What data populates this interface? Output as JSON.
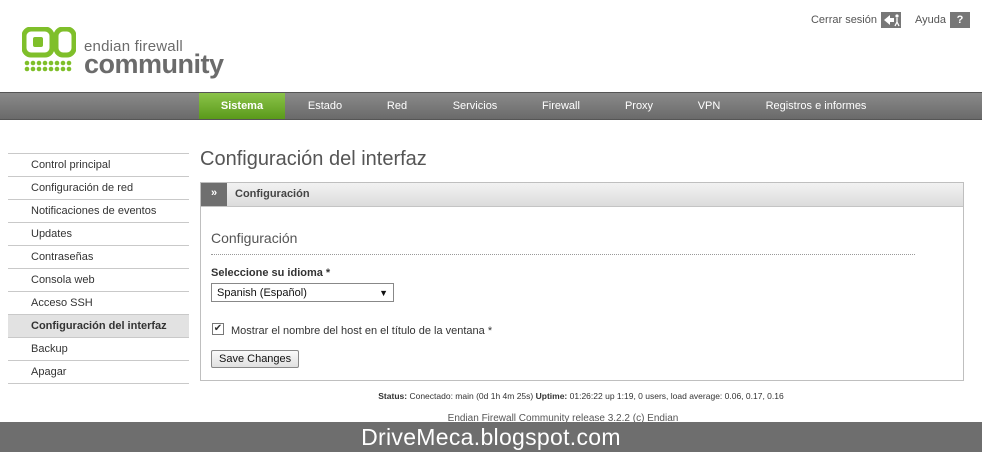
{
  "header": {
    "logo_line1": "endian firewall",
    "logo_line2": "community",
    "logout_label": "Cerrar sesión",
    "help_label": "Ayuda",
    "help_icon_glyph": "?"
  },
  "nav": {
    "items": [
      "Sistema",
      "Estado",
      "Red",
      "Servicios",
      "Firewall",
      "Proxy",
      "VPN",
      "Registros e informes"
    ],
    "active": "Sistema"
  },
  "sidebar": {
    "items": [
      "Control principal",
      "Configuración de red",
      "Notificaciones de eventos",
      "Updates",
      "Contraseñas",
      "Consola web",
      "Acceso SSH",
      "Configuración del interfaz",
      "Backup",
      "Apagar"
    ],
    "active": "Configuración del interfaz"
  },
  "main": {
    "page_title": "Configuración del interfaz",
    "panel_toggle": "»",
    "panel_title": "Configuración",
    "section_title": "Configuración",
    "language_label": "Seleccione su idioma *",
    "language_value": "Spanish (Español)",
    "language_arrow": "▼",
    "hostname_checkbox_label": "Mostrar el nombre del host en el título de la ventana *",
    "hostname_checkbox_checked": true,
    "check_glyph": "✔",
    "save_button": "Save Changes"
  },
  "status": {
    "status_label": "Status:",
    "status_value": "Conectado: main (0d 1h 4m 25s)",
    "uptime_label": "Uptime:",
    "uptime_value": "01:26:22 up 1:19, 0 users, load average: 0.06, 0.17, 0.16"
  },
  "footer_note": "Endian Firewall Community release 3.2.2 (c) Endian",
  "watermark": "DriveMeca.blogspot.com",
  "colors": {
    "accent_green": "#6aa820",
    "nav_gray": "#7a7a7a",
    "logo_green": "#7fbf2a"
  }
}
